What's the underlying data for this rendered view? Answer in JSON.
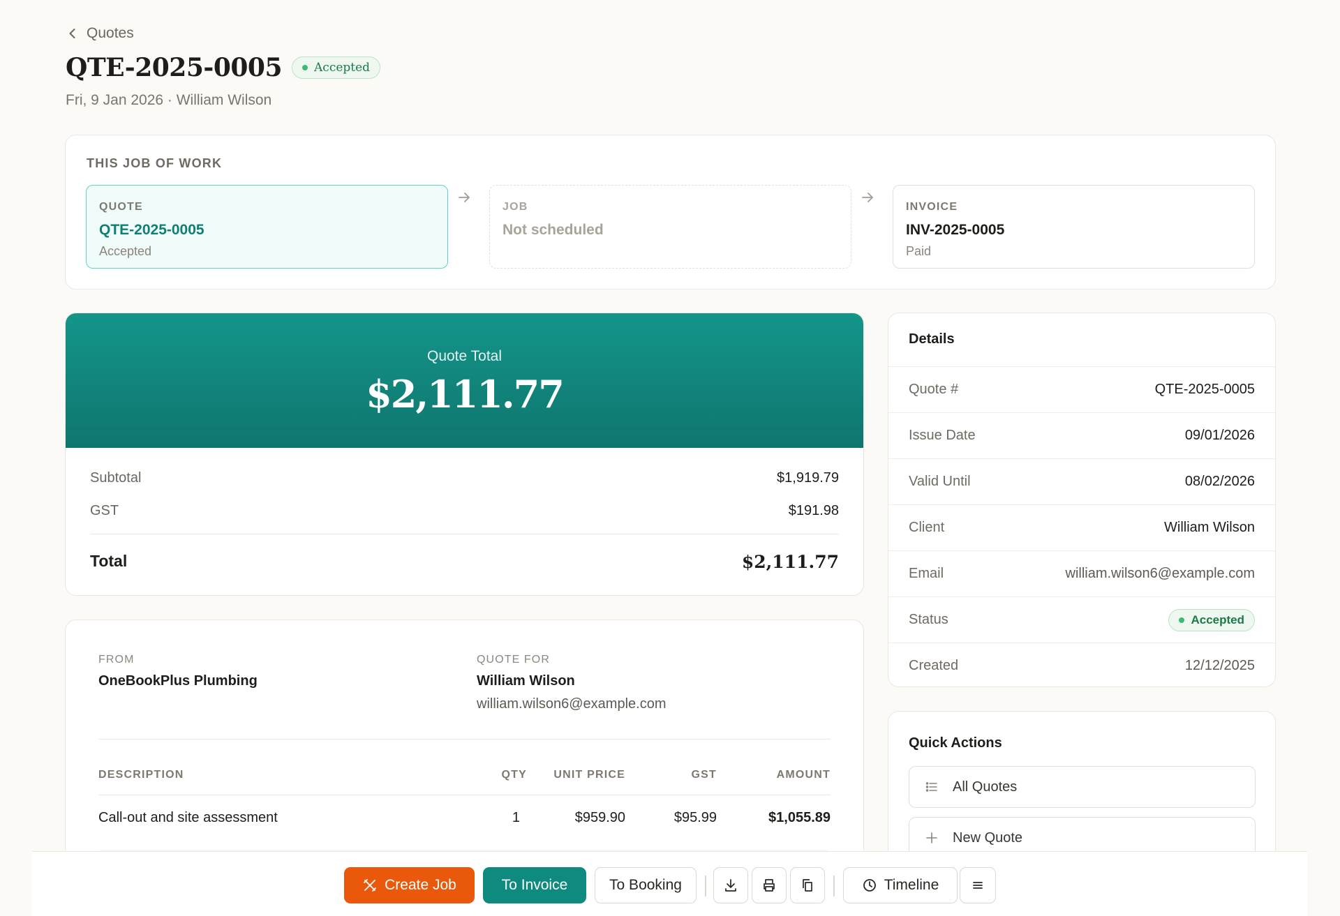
{
  "header": {
    "back_label": "Quotes",
    "title": "QTE-2025-0005",
    "status": "Accepted",
    "subline": "Fri, 9 Jan 2026 · William Wilson"
  },
  "workflow": {
    "section_label": "THIS JOB OF WORK",
    "steps": [
      {
        "label": "QUOTE",
        "value": "QTE-2025-0005",
        "sub": "Accepted"
      },
      {
        "label": "JOB",
        "value": "Not scheduled",
        "sub": ""
      },
      {
        "label": "INVOICE",
        "value": "INV-2025-0005",
        "sub": "Paid"
      }
    ]
  },
  "totals": {
    "banner_label": "Quote Total",
    "banner_value": "$2,111.77",
    "subtotal_label": "Subtotal",
    "subtotal_value": "$1,919.79",
    "gst_label": "GST",
    "gst_value": "$191.98",
    "total_label": "Total",
    "total_value": "$2,111.77"
  },
  "document": {
    "from_label": "FROM",
    "from_name": "OneBookPlus Plumbing",
    "for_label": "QUOTE FOR",
    "for_name": "William Wilson",
    "for_email": "william.wilson6@example.com",
    "columns": [
      "DESCRIPTION",
      "QTY",
      "UNIT PRICE",
      "GST",
      "AMOUNT"
    ],
    "rows": [
      {
        "description": "Call-out and site assessment",
        "qty": "1",
        "unit_price": "$959.90",
        "gst": "$95.99",
        "amount": "$1,055.89"
      }
    ]
  },
  "details": {
    "heading": "Details",
    "rows": [
      {
        "key": "Quote #",
        "value": "QTE-2025-0005"
      },
      {
        "key": "Issue Date",
        "value": "09/01/2026"
      },
      {
        "key": "Valid Until",
        "value": "08/02/2026"
      },
      {
        "key": "Client",
        "value": "William Wilson"
      },
      {
        "key": "Email",
        "value": "william.wilson6@example.com"
      },
      {
        "key": "Status",
        "value": "Accepted"
      },
      {
        "key": "Created",
        "value": "12/12/2025"
      }
    ]
  },
  "quick_actions": {
    "heading": "Quick Actions",
    "items": [
      {
        "label": "All Quotes",
        "icon": "list-icon"
      },
      {
        "label": "New Quote",
        "icon": "plus-icon"
      }
    ]
  },
  "toolbar": {
    "create_job": "Create Job",
    "to_invoice": "To Invoice",
    "to_booking": "To Booking",
    "timeline": "Timeline"
  },
  "colors": {
    "accent_teal": "#0f8a7e",
    "accent_orange": "#ea580c",
    "status_green": "#1b7a45"
  }
}
